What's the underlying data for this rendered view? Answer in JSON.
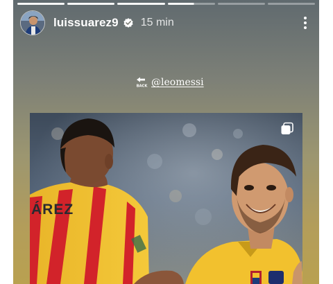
{
  "story": {
    "progress_segments": [
      {
        "state": "done"
      },
      {
        "state": "done"
      },
      {
        "state": "done"
      },
      {
        "state": "active",
        "fraction": 0.55
      },
      {
        "state": "upcoming"
      },
      {
        "state": "upcoming"
      }
    ]
  },
  "header": {
    "username": "luissuarez9",
    "time": "15 min",
    "verified_icon": "verified-badge-icon",
    "menu_icon": "more-options-icon"
  },
  "mention": {
    "handle": "@leomessi",
    "icon": "back-arrow-icon",
    "icon_label": "BACK"
  },
  "post": {
    "image_icon": "multiple-images-icon",
    "jersey_text": "ÁREZ",
    "colors": {
      "jersey_yellow": "#f2c12e",
      "jersey_red": "#d2232a",
      "background_top": "#606a6f",
      "background_bottom": "#b9a150"
    }
  }
}
